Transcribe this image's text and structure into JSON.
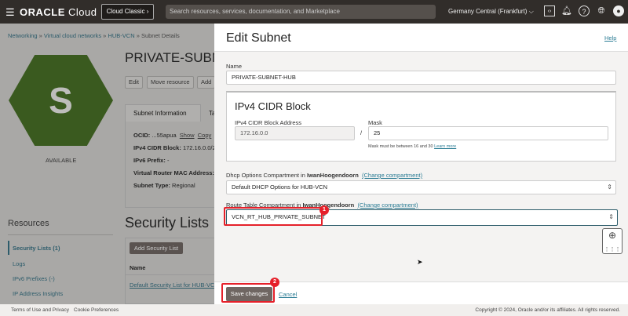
{
  "topbar": {
    "brand_bold": "ORACLE",
    "brand_light": "Cloud",
    "classic_button": "Cloud Classic ›",
    "search_placeholder": "Search resources, services, documentation, and Marketplace",
    "region": "Germany Central (Frankfurt)",
    "icons": [
      "menu-icon",
      "code-editor-icon",
      "bell-icon",
      "help-icon",
      "globe-icon",
      "user-icon"
    ]
  },
  "breadcrumb": [
    {
      "label": "Networking"
    },
    {
      "label": "Virtual cloud networks"
    },
    {
      "label": "HUB-VCN"
    },
    {
      "label": "Subnet Details"
    }
  ],
  "breadcrumb_sep": " » ",
  "subnet": {
    "icon_letter": "S",
    "status": "AVAILABLE",
    "title": "PRIVATE-SUBNET-HUB",
    "title_visible": "PRIVATE-SUBNE",
    "buttons": [
      "Edit",
      "Move resource",
      "Add"
    ],
    "tabs": [
      "Subnet Information",
      "Ta"
    ],
    "info": [
      {
        "k": "OCID:",
        "v": " ...55apua"
      },
      {
        "k": "IPv4 CIDR Block:",
        "v": " 172.16.0.0/2"
      },
      {
        "k": "IPv6 Prefix:",
        "v": " -"
      },
      {
        "k": "Virtual Router MAC Address:",
        "v": ""
      },
      {
        "k": "Subnet Type:",
        "v": " Regional"
      }
    ],
    "ocid_show": "Show",
    "ocid_copy": "Copy"
  },
  "resources": {
    "title": "Resources",
    "items": [
      {
        "label": "Security Lists (1)",
        "active": true
      },
      {
        "label": "Logs"
      },
      {
        "label": "IPv6 Prefixes (-)"
      },
      {
        "label": "IP Address Insights"
      }
    ]
  },
  "security_lists": {
    "title": "Security Lists",
    "add_button": "Add Security List",
    "column": "Name",
    "rows": [
      "Default Security List for HUB-VC"
    ]
  },
  "panel": {
    "title": "Edit Subnet",
    "help": "Help",
    "name_label": "Name",
    "name_value": "PRIVATE-SUBNET-HUB",
    "cidr_title": "IPv4 CIDR Block",
    "cidr_label": "IPv4 CIDR Block Address",
    "cidr_value": "172.16.0.0",
    "slash": "/",
    "mask_label": "Mask",
    "mask_value": "25",
    "mask_hint": "Mask must be between 16 and 30",
    "learn_more": "Learn more",
    "dhcp_label": "Dhcp Options Compartment in",
    "dhcp_compartment": "IwanHoogendoorn",
    "change_compartment": "(Change compartment)",
    "dhcp_value": "Default DHCP Options for HUB-VCN",
    "route_label": "Route Table Compartment in",
    "route_compartment": "IwanHoogendoorn",
    "route_value": "VCN_RT_HUB_PRIVATE_SUBNET",
    "save": "Save changes",
    "cancel": "Cancel",
    "badges": [
      "1",
      "2"
    ],
    "accent": "#e5202a"
  },
  "footer": {
    "links": [
      "Terms of Use and Privacy",
      "Cookie Preferences"
    ],
    "copyright": "Copyright © 2024, Oracle and/or its affiliates. All rights reserved."
  }
}
